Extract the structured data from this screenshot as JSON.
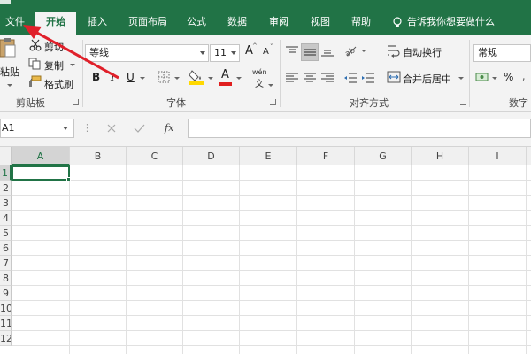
{
  "tabs": [
    "文件",
    "开始",
    "插入",
    "页面布局",
    "公式",
    "数据",
    "审阅",
    "视图",
    "帮助"
  ],
  "active_tab": "开始",
  "tell_me": "告诉我你想要做什么",
  "clipboard": {
    "paste": "粘贴",
    "cut": "剪切",
    "copy": "复制",
    "format_painter": "格式刷",
    "group_label": "剪贴板"
  },
  "font": {
    "name": "等线",
    "size": "11",
    "bold": "B",
    "italic": "I",
    "underline": "U",
    "grow": "A",
    "shrink": "A",
    "font_color": "A",
    "phonetic": "wén",
    "group_label": "字体"
  },
  "alignment": {
    "wrap_text": "自动换行",
    "merge_center": "合并后居中",
    "group_label": "对齐方式"
  },
  "number": {
    "format": "常规",
    "percent": "%",
    "group_label": "数字"
  },
  "formula_bar": {
    "name_box": "A1",
    "fx": "fx",
    "value": ""
  },
  "columns": [
    "A",
    "B",
    "C",
    "D",
    "E",
    "F",
    "G",
    "H",
    "I"
  ],
  "rows": [
    "1",
    "2",
    "3",
    "4",
    "5",
    "6",
    "7",
    "8",
    "9",
    "10",
    "11",
    "12"
  ],
  "active_cell": "A1",
  "colors": {
    "accent": "#217346",
    "annotation_arrow": "#e0202a",
    "highlight_yellow": "#ffd800",
    "font_red": "#e01f1f"
  }
}
